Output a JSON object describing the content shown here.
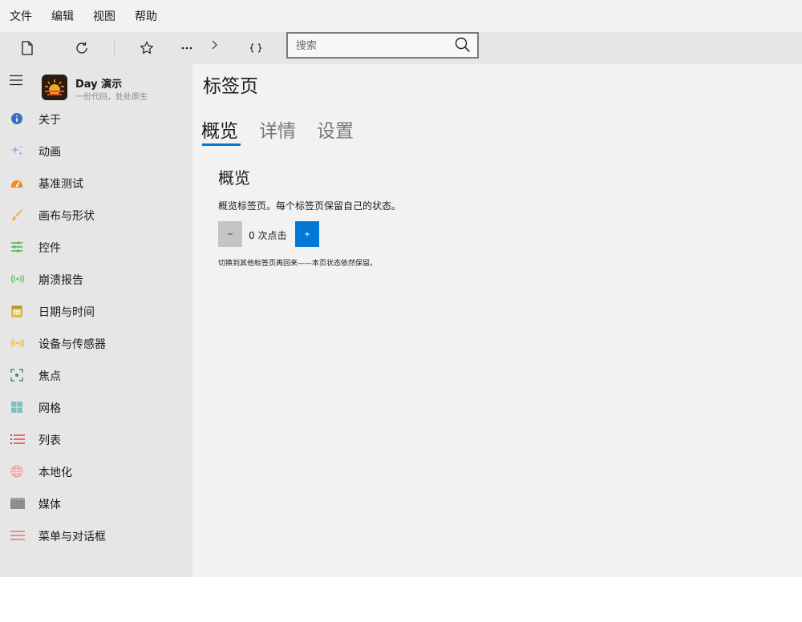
{
  "menubar": {
    "items": [
      "文件",
      "编辑",
      "视图",
      "帮助"
    ]
  },
  "toolbar": {
    "buttons": [
      "new-page-icon",
      "refresh-icon",
      "star-icon",
      "more-icon",
      "chevron-right-icon",
      "braces-icon"
    ],
    "search_placeholder": "搜索"
  },
  "sidebar": {
    "app_name": "Day 演示",
    "app_subtitle": "一份代码，处处原生",
    "items": [
      {
        "label": "关于",
        "icon": "info-icon",
        "color": "#3a78c9"
      },
      {
        "label": "动画",
        "icon": "sparkle-icon",
        "color": "#8fb8e8"
      },
      {
        "label": "基准测试",
        "icon": "speedometer-icon",
        "color": "#f08a24"
      },
      {
        "label": "画布与形状",
        "icon": "brush-icon",
        "color": "#f0b040"
      },
      {
        "label": "控件",
        "icon": "sliders-icon",
        "color": "#4caf50"
      },
      {
        "label": "崩溃报告",
        "icon": "broadcast-icon",
        "color": "#66bb6a"
      },
      {
        "label": "日期与时间",
        "icon": "calendar-icon",
        "color": "#c9a227"
      },
      {
        "label": "设备与传感器",
        "icon": "sensor-icon",
        "color": "#e6c229"
      },
      {
        "label": "焦点",
        "icon": "focus-icon",
        "color": "#3d8c7a"
      },
      {
        "label": "网格",
        "icon": "grid-icon",
        "color": "#7fbfc0"
      },
      {
        "label": "列表",
        "icon": "list-icon",
        "color": "#e53935"
      },
      {
        "label": "本地化",
        "icon": "globe-icon",
        "color": "#ef9a9a"
      },
      {
        "label": "媒体",
        "icon": "clapperboard-icon",
        "color": "#8d8d8d"
      },
      {
        "label": "菜单与对话框",
        "icon": "menu-lines-icon",
        "color": "#e57373"
      }
    ]
  },
  "main": {
    "title": "标签页",
    "tabs": [
      "概览",
      "详情",
      "设置"
    ],
    "active_tab": "概览",
    "accent": "#0078d7",
    "section_title": "概览",
    "description": "概览标签页。每个标签页保留自己的状态。",
    "minus_label": "−",
    "counter_text": "0 次点击",
    "plus_label": "+",
    "note": "切换到其他标签页再回来——本页状态依然保留。"
  }
}
